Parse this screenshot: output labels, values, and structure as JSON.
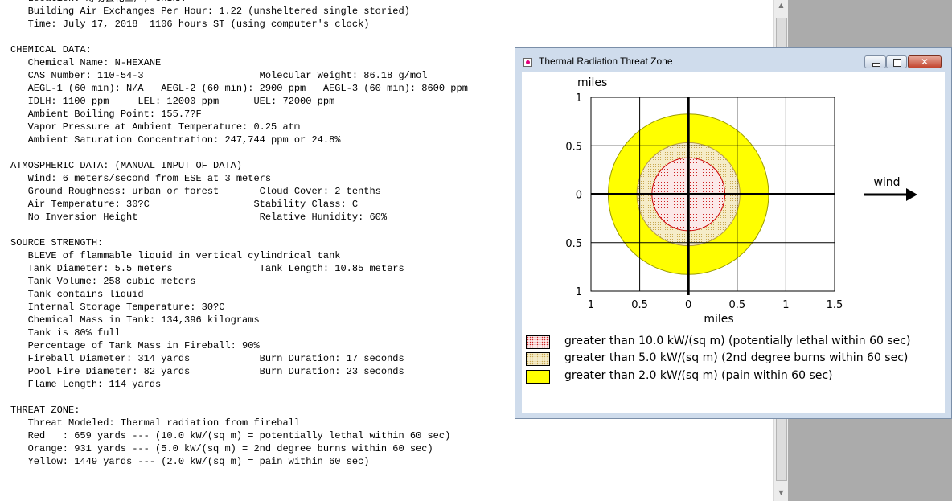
{
  "report": {
    "lines": [
      "   Location: 寿坊县化工厂, CHINA",
      "   Building Air Exchanges Per Hour: 1.22 (unsheltered single storied)",
      "   Time: July 17, 2018  1106 hours ST (using computer's clock)",
      "",
      "CHEMICAL DATA:",
      "   Chemical Name: N-HEXANE",
      "   CAS Number: 110-54-3                    Molecular Weight: 86.18 g/mol",
      "   AEGL-1 (60 min): N/A   AEGL-2 (60 min): 2900 ppm   AEGL-3 (60 min): 8600 ppm",
      "   IDLH: 1100 ppm     LEL: 12000 ppm      UEL: 72000 ppm",
      "   Ambient Boiling Point: 155.7?F",
      "   Vapor Pressure at Ambient Temperature: 0.25 atm",
      "   Ambient Saturation Concentration: 247,744 ppm or 24.8%",
      "",
      "ATMOSPHERIC DATA: (MANUAL INPUT OF DATA)",
      "   Wind: 6 meters/second from ESE at 3 meters",
      "   Ground Roughness: urban or forest       Cloud Cover: 2 tenths",
      "   Air Temperature: 30?C                  Stability Class: C",
      "   No Inversion Height                     Relative Humidity: 60%",
      "",
      "SOURCE STRENGTH:",
      "   BLEVE of flammable liquid in vertical cylindrical tank",
      "   Tank Diameter: 5.5 meters               Tank Length: 10.85 meters",
      "   Tank Volume: 258 cubic meters",
      "   Tank contains liquid",
      "   Internal Storage Temperature: 30?C",
      "   Chemical Mass in Tank: 134,396 kilograms",
      "   Tank is 80% full",
      "   Percentage of Tank Mass in Fireball: 90%",
      "   Fireball Diameter: 314 yards            Burn Duration: 17 seconds",
      "   Pool Fire Diameter: 82 yards            Burn Duration: 23 seconds",
      "   Flame Length: 114 yards",
      "",
      "THREAT ZONE:",
      "   Threat Modeled: Thermal radiation from fireball",
      "   Red   : 659 yards --- (10.0 kW/(sq m) = potentially lethal within 60 sec)",
      "   Orange: 931 yards --- (5.0 kW/(sq m) = 2nd degree burns within 60 sec)",
      "   Yellow: 1449 yards --- (2.0 kW/(sq m) = pain within 60 sec)"
    ]
  },
  "window": {
    "title": "Thermal Radiation Threat Zone",
    "close_glyph": "✕"
  },
  "plot": {
    "y_unit": "miles",
    "x_unit": "miles",
    "wind_label": "wind",
    "x_ticks": [
      {
        "v": -1,
        "label": "1"
      },
      {
        "v": -0.5,
        "label": "0.5"
      },
      {
        "v": 0,
        "label": "0"
      },
      {
        "v": 0.5,
        "label": "0.5"
      },
      {
        "v": 1,
        "label": "1"
      },
      {
        "v": 1.5,
        "label": "1.5"
      }
    ],
    "y_ticks": [
      {
        "v": 1,
        "label": "1"
      },
      {
        "v": 0.5,
        "label": "0.5"
      },
      {
        "v": 0,
        "label": "0"
      },
      {
        "v": -0.5,
        "label": "0.5"
      },
      {
        "v": -1,
        "label": "1"
      }
    ],
    "x_range": [
      -1,
      1.5
    ],
    "y_range": [
      -1,
      1
    ],
    "zones": [
      {
        "name": "yellow",
        "radius_yards": 1449,
        "fill": "#ffff00",
        "stroke": "#999900"
      },
      {
        "name": "orange",
        "radius_yards": 931,
        "fill": "#f5ecc8",
        "stroke": "#b59a48"
      },
      {
        "name": "red",
        "radius_yards": 659,
        "fill": "#fbe8e8",
        "stroke": "#cc0000"
      }
    ]
  },
  "legend": [
    {
      "label": "greater than 10.0 kW/(sq m) (potentially lethal within 60 sec)",
      "color": "#fbe8e8",
      "dot": "#cc2222"
    },
    {
      "label": "greater than 5.0 kW/(sq m) (2nd degree burns within 60 sec)",
      "color": "#f5ecc8",
      "dot": "#c8a850"
    },
    {
      "label": "greater than 2.0 kW/(sq m) (pain within 60 sec)",
      "color": "#ffff00",
      "dot": null
    }
  ]
}
